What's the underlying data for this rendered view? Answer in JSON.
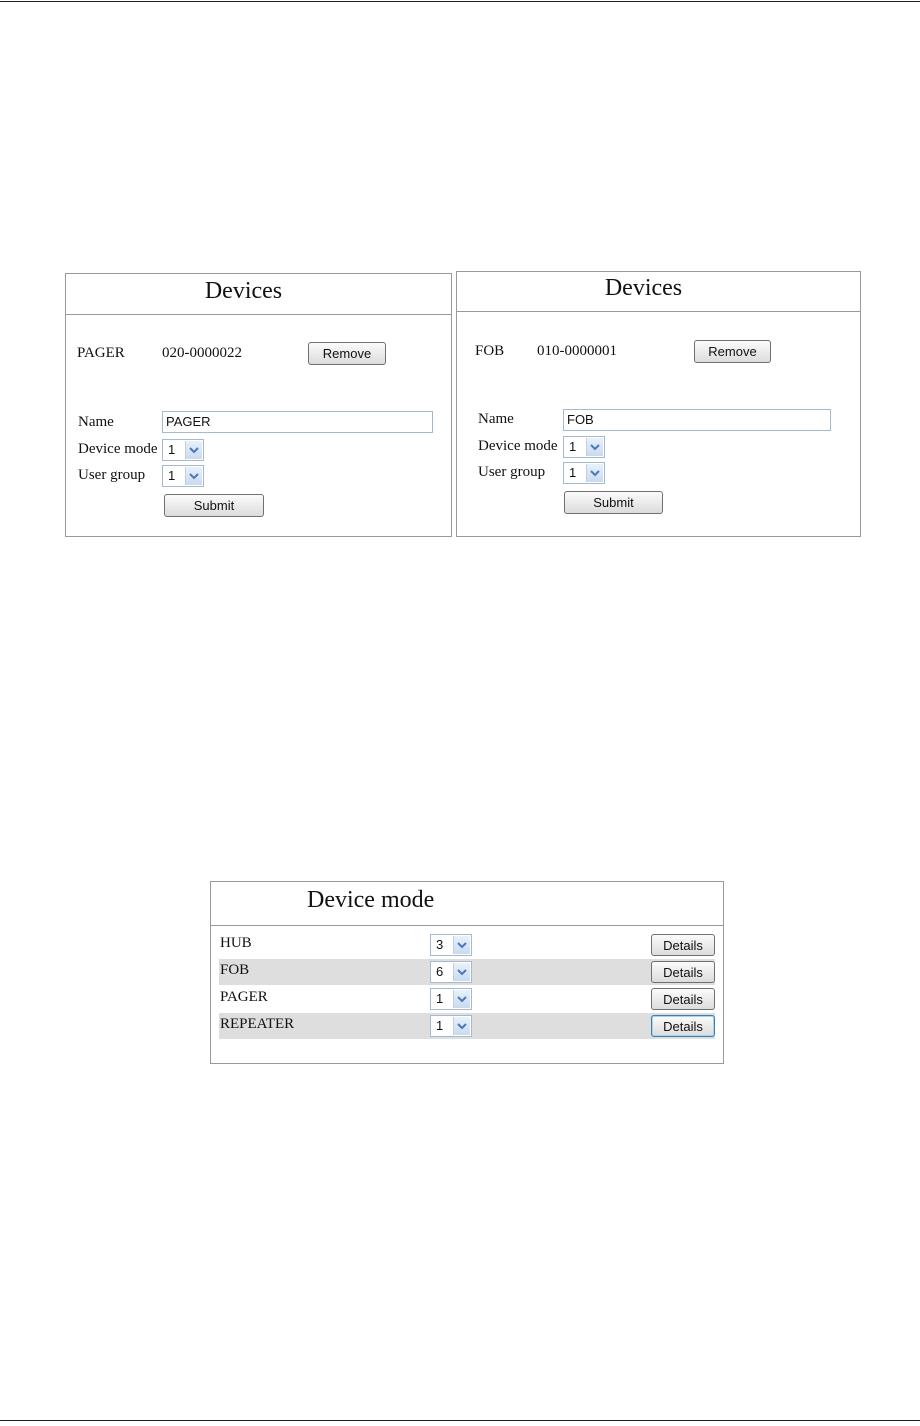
{
  "devices_panels": [
    {
      "title": "Devices",
      "device_type": "PAGER",
      "device_id": "020-0000022",
      "remove_label": "Remove",
      "name_label": "Name",
      "name_value": "PAGER",
      "device_mode_label": "Device mode",
      "device_mode_value": "1",
      "user_group_label": "User group",
      "user_group_value": "1",
      "submit_label": "Submit"
    },
    {
      "title": "Devices",
      "device_type": "FOB",
      "device_id": "010-0000001",
      "remove_label": "Remove",
      "name_label": "Name",
      "name_value": "FOB",
      "device_mode_label": "Device mode",
      "device_mode_value": "1",
      "user_group_label": "User group",
      "user_group_value": "1",
      "submit_label": "Submit"
    }
  ],
  "device_mode_panel": {
    "title": "Device mode",
    "rows": [
      {
        "device": "HUB",
        "mode": "3",
        "details_label": "Details"
      },
      {
        "device": "FOB",
        "mode": "6",
        "details_label": "Details"
      },
      {
        "device": "PAGER",
        "mode": "1",
        "details_label": "Details"
      },
      {
        "device": "REPEATER",
        "mode": "1",
        "details_label": "Details"
      }
    ]
  },
  "icons": {
    "dropdown": "chevron-down-icon"
  },
  "colors": {
    "panel_border": "#9a9a9a",
    "row_alt_bg": "#dedede",
    "input_border": "#a5b9cf",
    "dropdown_arrow": "#4a78b8"
  }
}
